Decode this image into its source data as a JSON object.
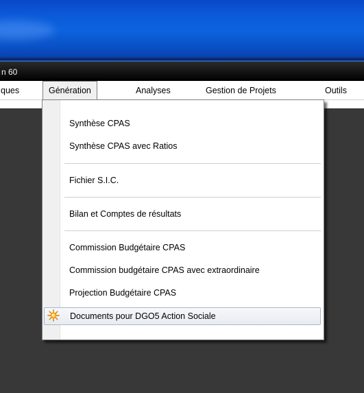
{
  "window": {
    "caption": "n 60"
  },
  "menubar": {
    "items": [
      {
        "label": "ques",
        "open": false
      },
      {
        "label": "Génération",
        "open": true
      },
      {
        "label": "Analyses",
        "open": false
      },
      {
        "label": "Gestion de Projets",
        "open": false
      },
      {
        "label": "Outils",
        "open": false
      }
    ]
  },
  "dropdown": {
    "items": [
      {
        "label": "Synthèse CPAS"
      },
      {
        "label": "Synthèse CPAS avec Ratios"
      },
      {
        "label": "Fichier S.I.C."
      },
      {
        "label": "Bilan et Comptes de résultats"
      },
      {
        "label": "Commission Budgétaire CPAS"
      },
      {
        "label": "Commission budgétaire CPAS avec extraordinaire"
      },
      {
        "label": "Projection Budgétaire CPAS"
      },
      {
        "label": "Documents pour DGO5 Action Sociale",
        "icon": "starburst-icon",
        "highlighted": true
      }
    ]
  },
  "colors": {
    "title_band": "#0c63de",
    "menu_highlight_border": "#a9b8c7",
    "background": "#383838"
  }
}
